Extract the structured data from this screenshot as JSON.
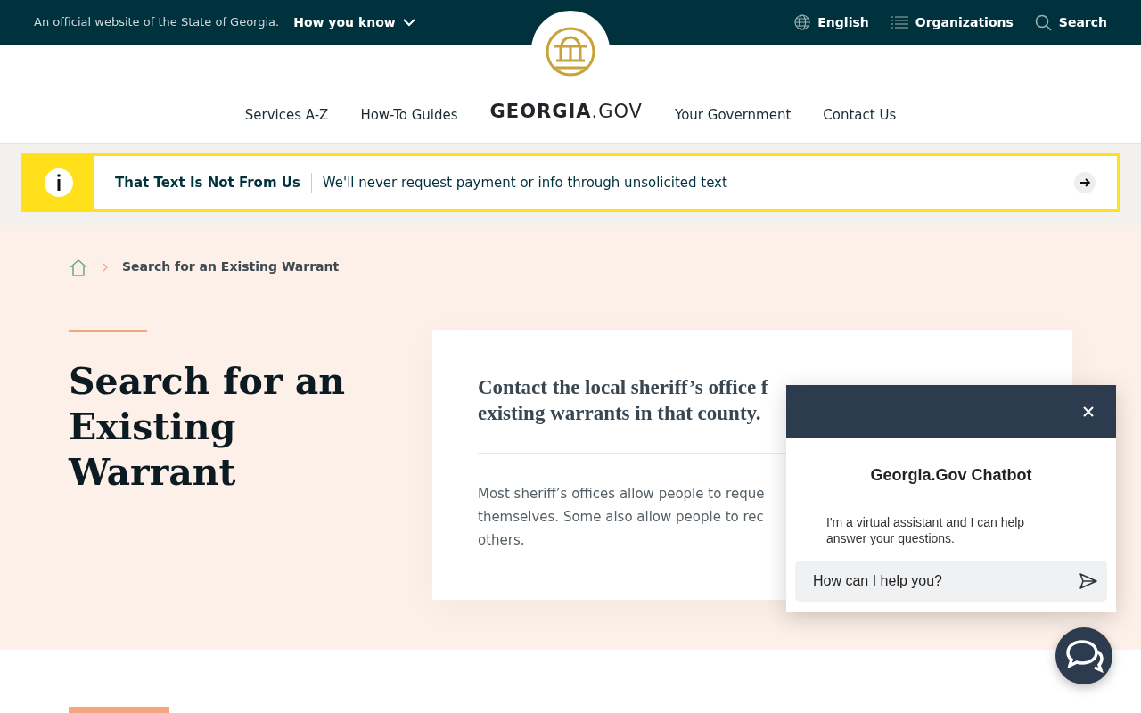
{
  "top_bar": {
    "official_text": "An official website of the State of Georgia.",
    "how_you_know": "How you know",
    "links": [
      {
        "kind": "globe",
        "label": "English"
      },
      {
        "kind": "list",
        "label": "Organizations"
      },
      {
        "kind": "search",
        "label": "Search"
      }
    ]
  },
  "header": {
    "logo_name": "GEORGIA",
    "logo_suffix": ".GOV",
    "nav_left": [
      "Services A-Z",
      "How-To Guides"
    ],
    "nav_right": [
      "Your Government",
      "Contact Us"
    ]
  },
  "alert": {
    "title": "That Text Is Not From Us",
    "message": "We'll never request payment or info through unsolicited text"
  },
  "breadcrumb": {
    "current": "Search for an Existing Warrant"
  },
  "page": {
    "title": "Search for an Existing Warrant"
  },
  "card": {
    "lead_lines": [
      "Contact the local sheriff’s office f",
      "existing warrants in that county."
    ],
    "body_lines": [
      "Most sheriff’s offices allow people to reque",
      "themselves. Some also allow people to rec",
      "others."
    ]
  },
  "chatbot": {
    "title": "Georgia.Gov Chatbot",
    "message": "I'm a virtual assistant and I can help answer your questions.",
    "input": {
      "placeholder": "How can I help you?"
    }
  }
}
